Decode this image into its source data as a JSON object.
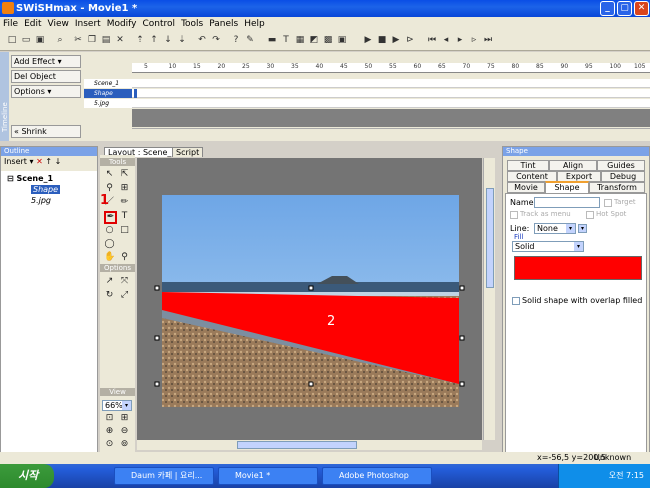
{
  "window": {
    "title": "SWiSHmax - Movie1 *"
  },
  "menu": [
    "File",
    "Edit",
    "View",
    "Insert",
    "Modify",
    "Control",
    "Tools",
    "Panels",
    "Help"
  ],
  "effects": {
    "add": "Add Effect",
    "del": "Del Object",
    "options": "Options",
    "shrink": "Shrink",
    "strip": "Timeline"
  },
  "timeline": {
    "ruler": [
      "5",
      "10",
      "15",
      "20",
      "25",
      "30",
      "35",
      "40",
      "45",
      "50",
      "55",
      "60",
      "65",
      "70",
      "75",
      "80",
      "85",
      "90",
      "95",
      "100",
      "105"
    ],
    "rows": [
      "Scene_1",
      "Shape",
      "5.jpg"
    ]
  },
  "outline": {
    "header": "Outline",
    "insert": "Insert",
    "tree": [
      "Scene_1",
      "Shape",
      "5.jpg"
    ]
  },
  "tools": {
    "header": "Tools",
    "options": "Options",
    "view": "View",
    "zoom": "66%"
  },
  "stage": {
    "tabs": [
      "Layout : Scene_1",
      "Script"
    ]
  },
  "annotations": {
    "one": "1",
    "two": "2"
  },
  "shape": {
    "header": "Shape",
    "tabs_row1": [
      "Tint",
      "Align",
      "Guides"
    ],
    "tabs_row2": [
      "Content",
      "Export",
      "Debug"
    ],
    "tabs_row3": [
      "Movie",
      "Shape",
      "Transform"
    ],
    "name_label": "Name:",
    "target": "Target",
    "track_as_menu": "Track as menu",
    "hot_spot": "Hot Spot",
    "line_label": "Line:",
    "line_value": "None",
    "fill_label": "Fill",
    "fill_value": "Solid",
    "fill_color": "#ff0000",
    "solid_overlap": "Solid shape with overlap filled"
  },
  "status": {
    "coords": "x=-56,5 y=200,5",
    "size": "Unknown Size"
  },
  "taskbar": {
    "start": "시작",
    "items": [
      "Daum 카페 | 요리...",
      "Movie1 *",
      "Adobe Photoshop"
    ],
    "clock": "오전 7:15"
  }
}
